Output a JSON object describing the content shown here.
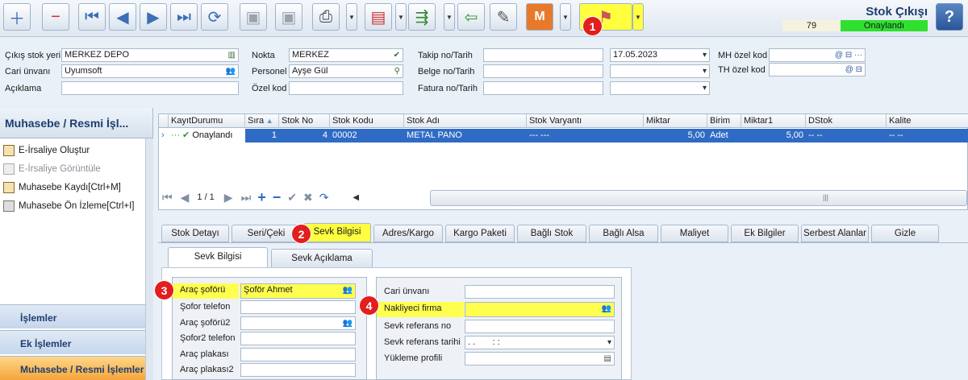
{
  "header": {
    "title": "Stok Çıkışı",
    "number": "79",
    "status": "Onaylandı"
  },
  "toolbar": {
    "badge1": "1"
  },
  "form": {
    "cikis_label": "Çıkış stok yeri",
    "cikis_value": "MERKEZ DEPO",
    "cari_label": "Cari ünvanı",
    "cari_value": "Uyumsoft",
    "aciklama_label": "Açıklama",
    "nokta_label": "Nokta",
    "nokta_value": "MERKEZ",
    "personel_label": "Personel",
    "personel_value": "Ayşe Gül",
    "ozelkod_label": "Özel kod",
    "takip_label": "Takip no/Tarih",
    "takip_date": "17.05.2023",
    "belge_label": "Belge no/Tarih",
    "fatura_label": "Fatura no/Tarih",
    "mh_label": "MH özel kod",
    "th_label": "TH özel kod"
  },
  "left": {
    "title": "Muhasebe / Resmi İşl...",
    "items": [
      "E-İrsaliye Oluştur",
      "E-İrsaliye Görüntüle",
      "Muhasebe Kaydı[Ctrl+M]",
      "Muhasebe Ön İzleme[Ctrl+I]"
    ],
    "bars": [
      "İşlemler",
      "Ek İşlemler",
      "Muhasebe / Resmi İşlemler"
    ]
  },
  "grid": {
    "columns": [
      "KayıtDurumu",
      "Sıra",
      "Stok No",
      "Stok Kodu",
      "Stok Adı",
      "Stok Varyantı",
      "Miktar",
      "Birim",
      "Miktar1",
      "DStok",
      "Kalite"
    ],
    "row": {
      "durum": "Onaylandı",
      "sira": "1",
      "stokno": "4",
      "stokkodu": "00002",
      "stokadi": "METAL PANO",
      "varyant": "--- ---",
      "miktar": "5,00",
      "birim": "Adet",
      "miktar1": "5,00",
      "dstok": "-- --",
      "kalite": "-- --"
    },
    "pager": "1 / 1"
  },
  "tabs": [
    "Stok Detayı",
    "Seri/Çeki",
    "Sevk Bilgisi",
    "Adres/Kargo",
    "Kargo Paketi",
    "Bağlı Stok",
    "Bağlı Alsa",
    "Maliyet",
    "Ek Bilgiler",
    "Serbest Alanlar",
    "Gizle"
  ],
  "subtabs": [
    "Sevk Bilgisi",
    "Sevk Açıklama"
  ],
  "sevk": {
    "sofor_label": "Araç şoförü",
    "sofor_value": "Şoför Ahmet",
    "tel_label": "Şofor telefon",
    "sofor2_label": "Araç şoförü2",
    "tel2_label": "Şofor2 telefon",
    "plaka_label": "Araç plakası",
    "plaka2_label": "Araç plakası2"
  },
  "sevk2": {
    "cari_label": "Cari ünvanı",
    "nakliyeci_label": "Nakliyeci firma",
    "refno_label": "Sevk referans no",
    "reftarih_label": "Sevk referans tarihi",
    "reftarih_value": ". .       : :",
    "profil_label": "Yükleme profili"
  },
  "badges": [
    "1",
    "2",
    "3",
    "4"
  ]
}
